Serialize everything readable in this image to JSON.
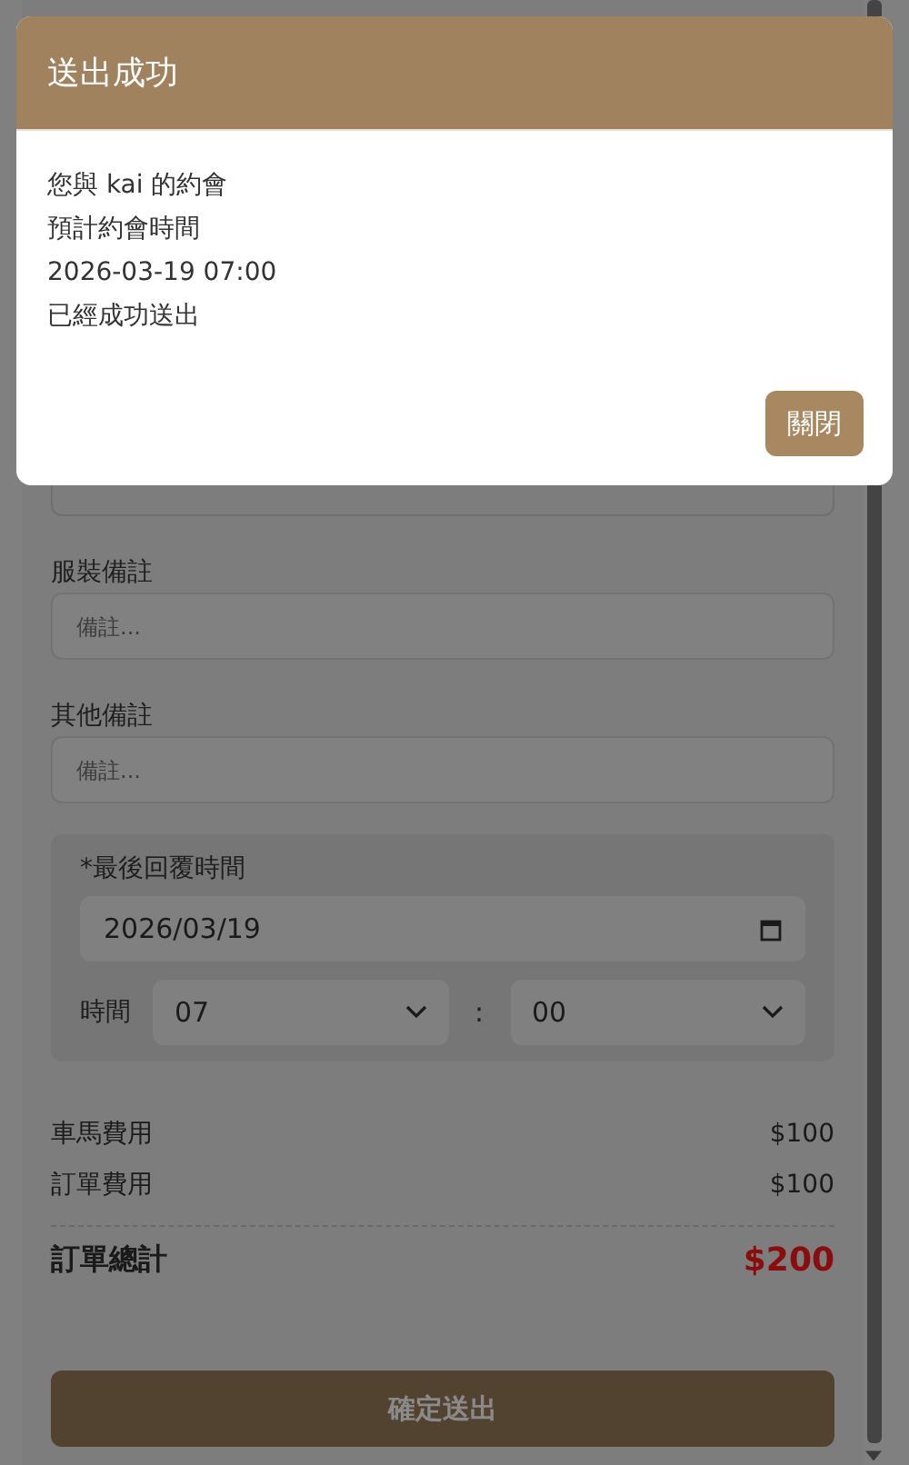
{
  "form": {
    "fields": [
      {
        "label": "服裝備註",
        "placeholder": "備註..."
      },
      {
        "label": "其他備註",
        "placeholder": "備註..."
      }
    ],
    "deadline": {
      "label": "*最後回覆時間",
      "date": "2026/03/19",
      "time_label": "時間",
      "hour": "07",
      "separator": ":",
      "minute": "00"
    },
    "fees": [
      {
        "label": "車馬費用",
        "amount": "$100"
      },
      {
        "label": "訂單費用",
        "amount": "$100"
      }
    ],
    "total": {
      "label": "訂單總計",
      "amount": "$200"
    },
    "submit": {
      "label": "確定送出"
    }
  },
  "dialog": {
    "title": "送出成功",
    "lines": [
      "您與 kai 的約會",
      "預計約會時間",
      "2026-03-19 07:00",
      "已經成功送出"
    ],
    "button": "關閉"
  }
}
